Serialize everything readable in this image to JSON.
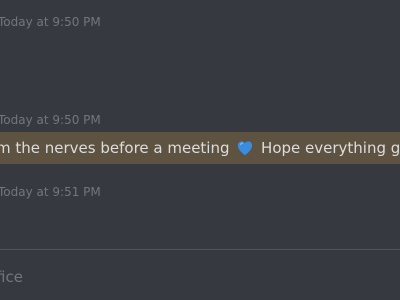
{
  "messages": [
    {
      "timestamp": "Today at 9:50 PM"
    },
    {
      "timestamp": "Today at 9:50 PM",
      "text_before": "m the nerves before a meeting ",
      "emoji": "blue-heart-icon",
      "text_after": " Hope everything goes w",
      "highlight_color": "#5e5240"
    },
    {
      "timestamp": "Today at 9:51 PM"
    }
  ],
  "composer": {
    "placeholder": "fice"
  },
  "colors": {
    "background": "#36393f",
    "timestamp": "#72767d",
    "message_text": "#dcddde",
    "divider": "#4f545c",
    "emoji_heart": "#3a8dde"
  }
}
